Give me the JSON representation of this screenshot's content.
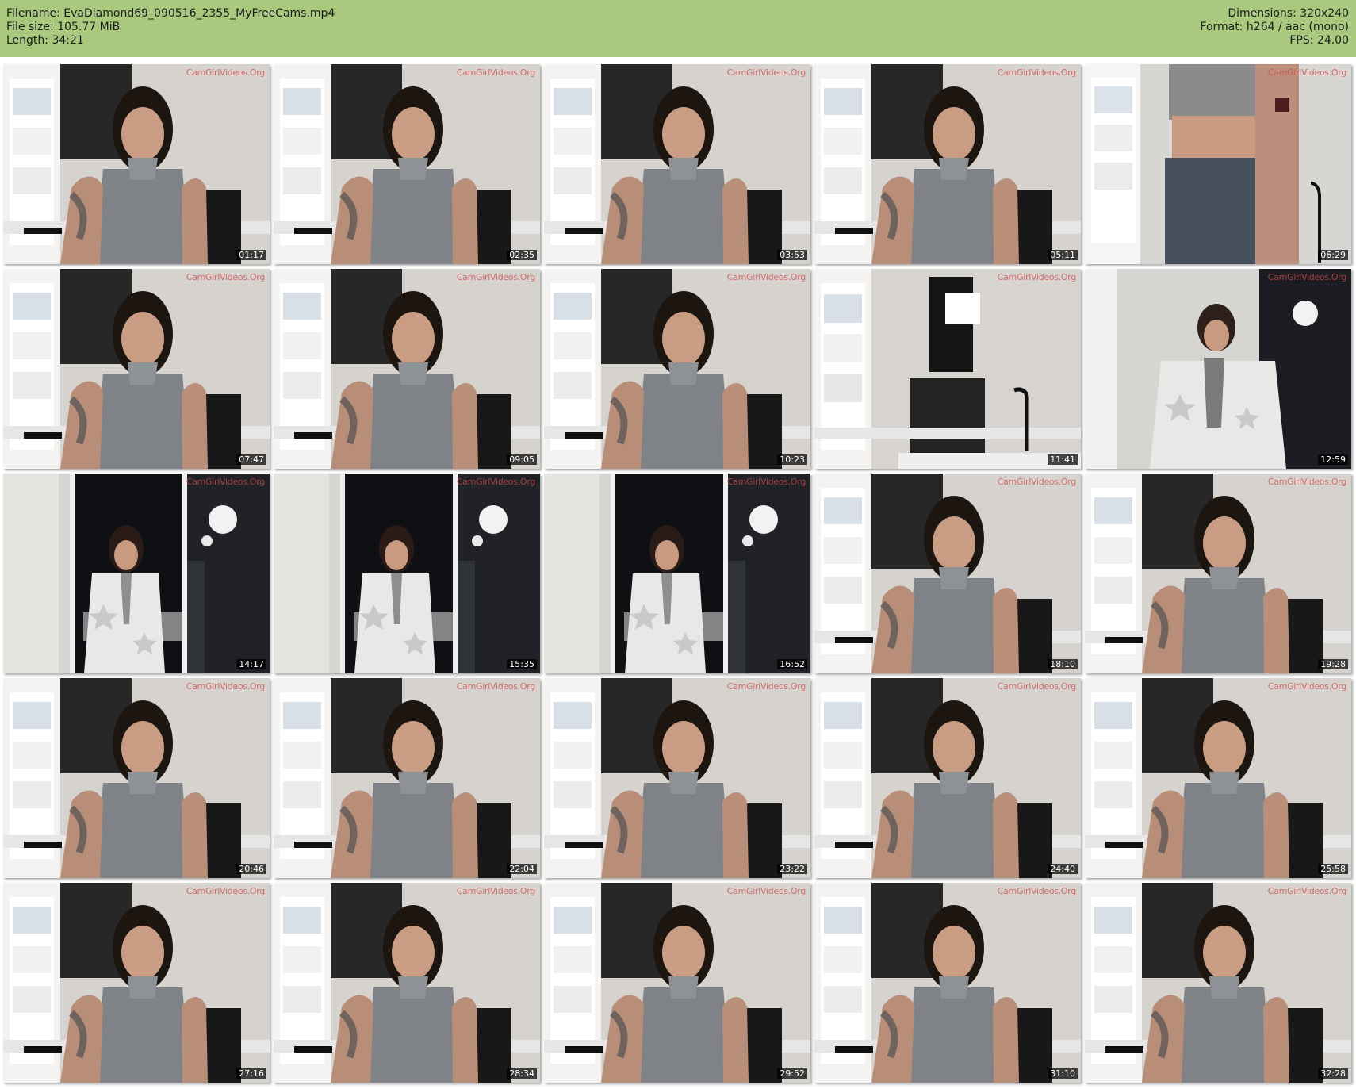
{
  "header": {
    "filename": "Filename: EvaDiamond69_090516_2355_MyFreeCams.mp4",
    "file_size": "File size: 105.77 MiB",
    "length": "Length: 34:21",
    "dimensions": "Dimensions: 320x240",
    "format": "Format: h264 / aac (mono)",
    "fps": "FPS: 24.00"
  },
  "colors": {
    "header_bg": "#a8c97e",
    "page_bg": "#ffffff",
    "timestamp_bg": "#000000",
    "watermark": "#d14a4a"
  },
  "thumbnails": [
    {
      "time": "01:17",
      "scene": "desk",
      "watermark": "CamGirlVideos.Org"
    },
    {
      "time": "02:35",
      "scene": "desk",
      "watermark": "CamGirlVideos.Org"
    },
    {
      "time": "03:53",
      "scene": "desk",
      "watermark": "CamGirlVideos.Org"
    },
    {
      "time": "05:11",
      "scene": "desk",
      "watermark": "CamGirlVideos.Org"
    },
    {
      "time": "06:29",
      "scene": "standing",
      "watermark": "CamGirlVideos.Org"
    },
    {
      "time": "07:47",
      "scene": "desk",
      "watermark": "CamGirlVideos.Org"
    },
    {
      "time": "09:05",
      "scene": "desk",
      "watermark": "CamGirlVideos.Org"
    },
    {
      "time": "10:23",
      "scene": "desk",
      "watermark": "CamGirlVideos.Org"
    },
    {
      "time": "11:41",
      "scene": "empty-chair",
      "watermark": "CamGirlVideos.Org"
    },
    {
      "time": "12:59",
      "scene": "robe-close",
      "watermark": "CamGirlVideos.Org"
    },
    {
      "time": "14:17",
      "scene": "window-robe",
      "watermark": "CamGirlVideos.Org"
    },
    {
      "time": "15:35",
      "scene": "window-robe",
      "watermark": "CamGirlVideos.Org"
    },
    {
      "time": "16:52",
      "scene": "window-robe",
      "watermark": "CamGirlVideos.Org"
    },
    {
      "time": "18:10",
      "scene": "desk",
      "watermark": "CamGirlVideos.Org"
    },
    {
      "time": "19:28",
      "scene": "desk",
      "watermark": "CamGirlVideos.Org"
    },
    {
      "time": "20:46",
      "scene": "desk",
      "watermark": "CamGirlVideos.Org"
    },
    {
      "time": "22:04",
      "scene": "desk",
      "watermark": "CamGirlVideos.Org"
    },
    {
      "time": "23:22",
      "scene": "desk",
      "watermark": "CamGirlVideos.Org"
    },
    {
      "time": "24:40",
      "scene": "desk",
      "watermark": "CamGirlVideos.Org"
    },
    {
      "time": "25:58",
      "scene": "desk",
      "watermark": "CamGirlVideos.Org"
    },
    {
      "time": "27:16",
      "scene": "desk",
      "watermark": "CamGirlVideos.Org"
    },
    {
      "time": "28:34",
      "scene": "desk",
      "watermark": "CamGirlVideos.Org"
    },
    {
      "time": "29:52",
      "scene": "desk",
      "watermark": "CamGirlVideos.Org"
    },
    {
      "time": "31:10",
      "scene": "desk",
      "watermark": "CamGirlVideos.Org"
    },
    {
      "time": "32:28",
      "scene": "desk",
      "watermark": "CamGirlVideos.Org"
    }
  ]
}
